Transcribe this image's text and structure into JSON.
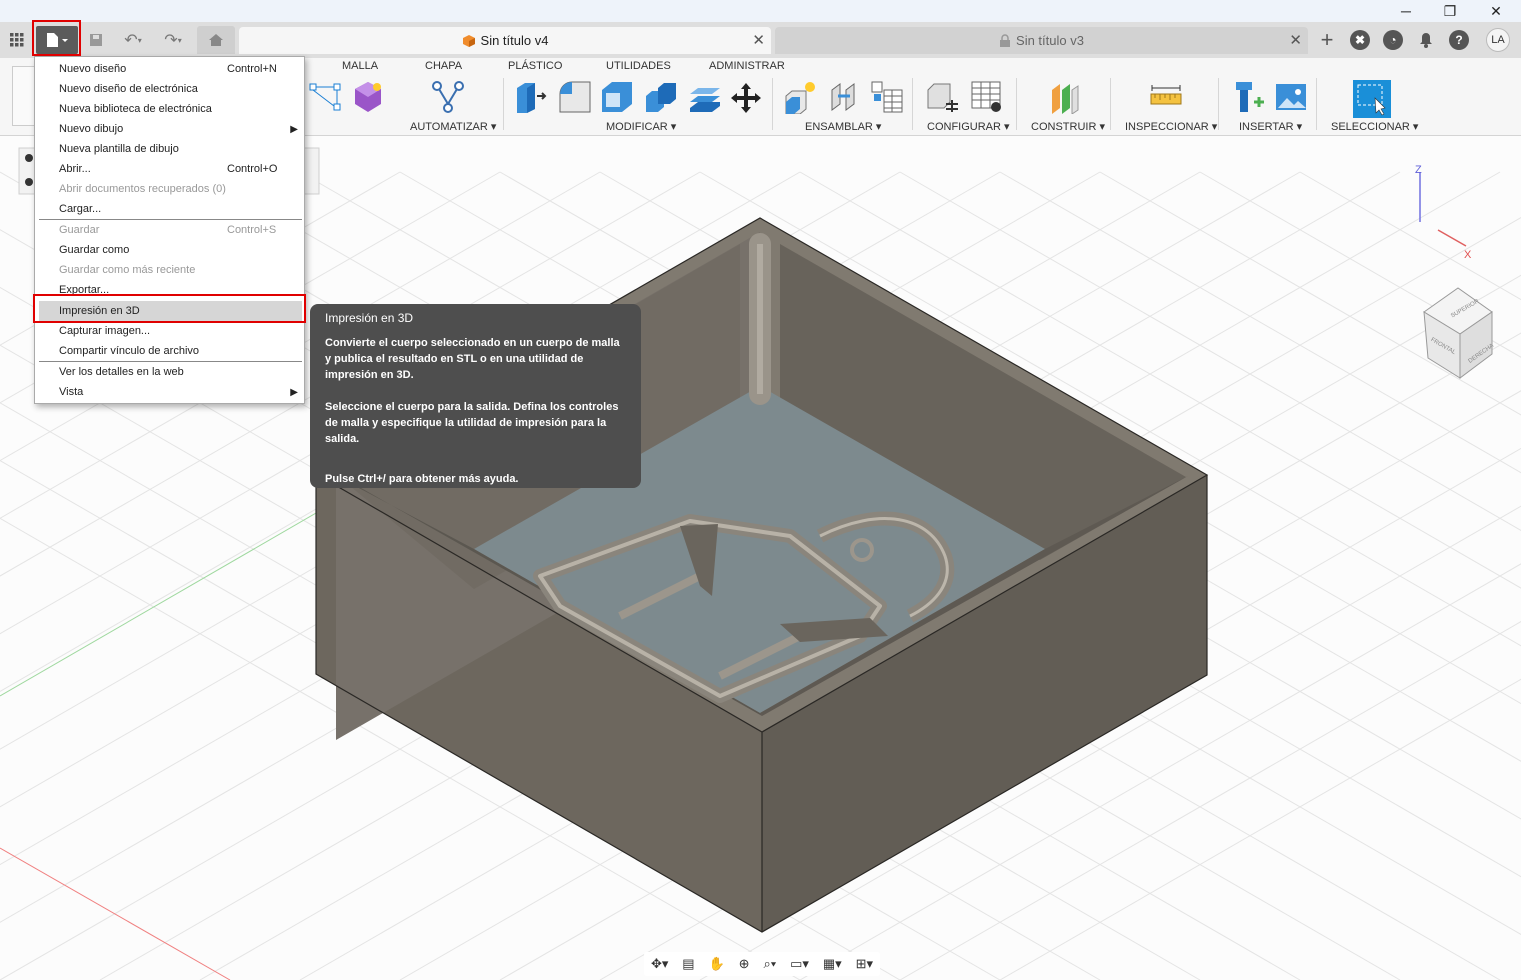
{
  "window": {
    "minimize_label": "─",
    "restore_label": "❐",
    "close_label": "✕"
  },
  "tabs": [
    {
      "label": "Sin título v4",
      "close": "✕"
    },
    {
      "label": "Sin título v3",
      "close": "✕"
    }
  ],
  "user": {
    "initials": "LA"
  },
  "ribbon": {
    "tabs": [
      "MALLA",
      "CHAPA",
      "PLÁSTICO",
      "UTILIDADES",
      "ADMINISTRAR"
    ],
    "groups": [
      "AUTOMATIZAR",
      "MODIFICAR",
      "ENSAMBLAR",
      "CONFIGURAR",
      "CONSTRUIR",
      "INSPECCIONAR",
      "INSERTAR",
      "SELECCIONAR"
    ]
  },
  "file_menu": {
    "items": [
      {
        "label": "Nuevo diseño",
        "shortcut": "Control+N"
      },
      {
        "label": "Nuevo diseño de electrónica",
        "shortcut": ""
      },
      {
        "label": "Nueva biblioteca de electrónica",
        "shortcut": ""
      },
      {
        "label": "Nuevo dibujo",
        "shortcut": ""
      },
      {
        "label": "Nueva plantilla de dibujo",
        "shortcut": ""
      },
      {
        "label": "Abrir...",
        "shortcut": "Control+O"
      },
      {
        "label": "Abrir documentos recuperados (0)",
        "shortcut": ""
      },
      {
        "label": "Cargar...",
        "shortcut": ""
      },
      {
        "label": "Guardar",
        "shortcut": "Control+S"
      },
      {
        "label": "Guardar como",
        "shortcut": ""
      },
      {
        "label": "Guardar como más reciente",
        "shortcut": ""
      },
      {
        "label": "Exportar...",
        "shortcut": ""
      },
      {
        "label": "Impresión en 3D",
        "shortcut": ""
      },
      {
        "label": "Capturar imagen...",
        "shortcut": ""
      },
      {
        "label": "Compartir vínculo de archivo",
        "shortcut": ""
      },
      {
        "label": "Ver los detalles en la web",
        "shortcut": ""
      },
      {
        "label": "Vista",
        "shortcut": ""
      }
    ]
  },
  "tooltip": {
    "title": "Impresión en 3D",
    "p1": "Convierte el cuerpo seleccionado en un cuerpo de malla y publica el resultado en STL o en una utilidad de impresión en 3D.",
    "p2": "Seleccione el cuerpo para la salida. Defina los controles de malla y especifique la utilidad de impresión para la salida.",
    "p3": "Pulse Ctrl+/ para obtener más ayuda."
  },
  "viewcube": {
    "top": "SUPERIOR",
    "front": "FRONTAL",
    "right": "DERECHA",
    "z": "Z",
    "x": "X"
  },
  "colors": {
    "highlight": "#e00000",
    "model": "#67625a",
    "tooltip_bg": "#4e4e4e"
  }
}
